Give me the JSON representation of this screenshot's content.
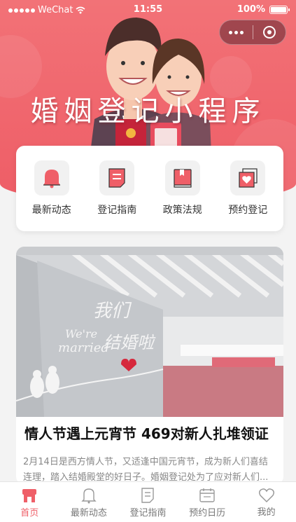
{
  "status_bar": {
    "carrier": "WeChat",
    "time": "11:55",
    "battery": "100%"
  },
  "banner": {
    "title": "婚姻登记小程序"
  },
  "menu": [
    {
      "label": "最新动态",
      "icon": "bell-icon"
    },
    {
      "label": "登记指南",
      "icon": "document-icon"
    },
    {
      "label": "政策法规",
      "icon": "book-icon"
    },
    {
      "label": "预约登记",
      "icon": "heart-calendar-icon"
    }
  ],
  "news": {
    "title": "情人节遇上元宵节 469对新人扎堆领证",
    "summary": "2月14日是西方情人节，又适逢中国元宵节，成为新人们喜结连理，踏入结婚殿堂的好日子。婚姻登记处为了应对新人们..."
  },
  "tabbar": [
    {
      "label": "首页",
      "icon": "home-icon",
      "active": true
    },
    {
      "label": "最新动态",
      "icon": "bell-icon",
      "active": false
    },
    {
      "label": "登记指南",
      "icon": "document-icon",
      "active": false
    },
    {
      "label": "预约日历",
      "icon": "calendar-icon",
      "active": false
    },
    {
      "label": "我的",
      "icon": "heart-icon",
      "active": false
    }
  ],
  "colors": {
    "accent": "#ef5f68",
    "banner": "#f27277"
  }
}
